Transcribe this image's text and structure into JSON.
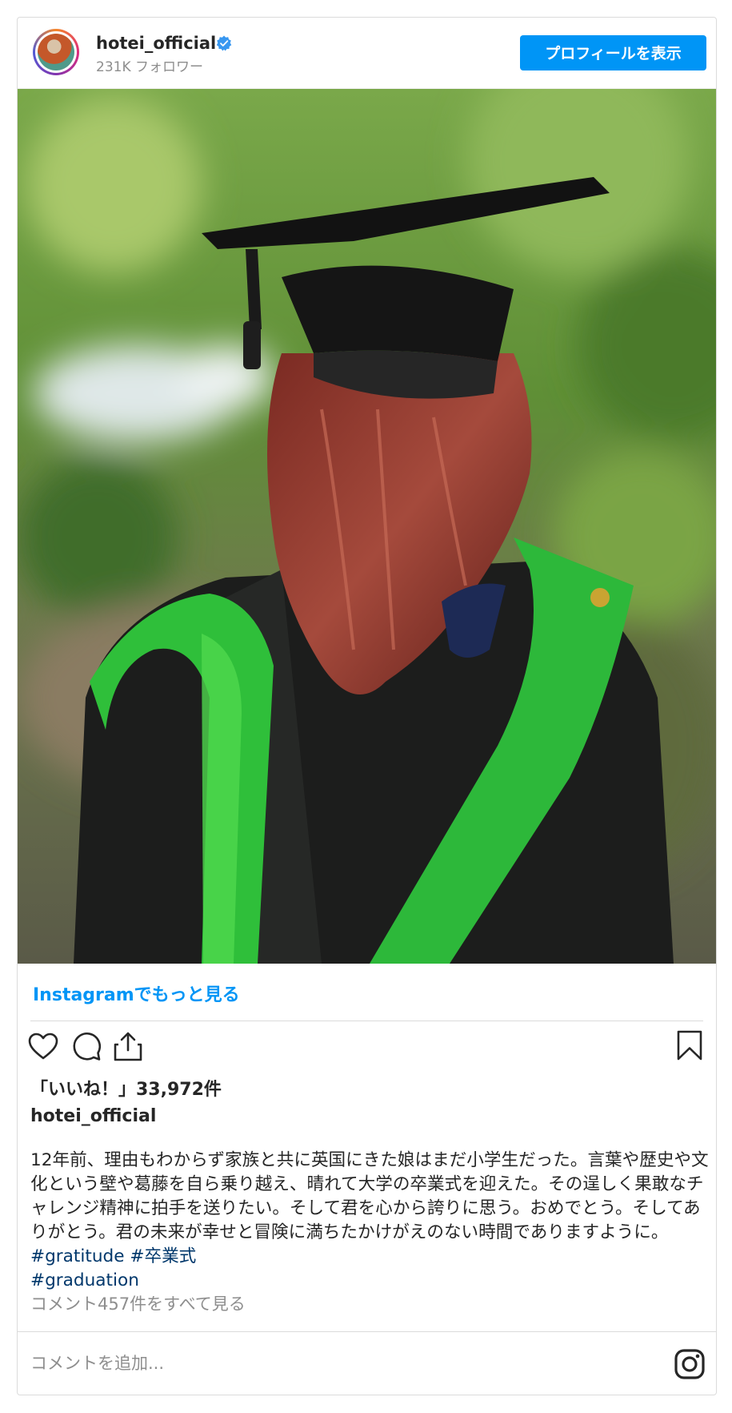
{
  "header": {
    "username": "hotei_official",
    "followers": "231K フォロワー",
    "profile_button": "プロフィールを表示"
  },
  "post": {
    "more_link": "Instagramでもっと見る",
    "likes": "「いいね！」33,972件",
    "caption_user": "hotei_official",
    "caption_text": "12年前、理由もわからず家族と共に英国にきた娘はまだ小学生だった。言葉や歴史や文化という壁や葛藤を自ら乗り越え、晴れて大学の卒業式を迎えた。その逞しく果敢なチャレンジ精神に拍手を送りたい。そして君を心から誇りに思う。おめでとう。そしてありがとう。君の未来が幸せと冒険に満ちたかけがえのない時間でありますように。　",
    "hashtags": [
      "#gratitude",
      "#卒業式",
      "#graduation"
    ],
    "view_comments": "コメント457件をすべて見る"
  },
  "comment_box": {
    "placeholder": "コメントを追加..."
  },
  "colors": {
    "accent": "#0095f6",
    "hashtag": "#00376b",
    "secondary_text": "#8e8e8e",
    "sash_green": "#2fbf3a"
  },
  "icons": [
    "verified-badge-icon",
    "heart-icon",
    "comment-icon",
    "share-icon",
    "bookmark-icon",
    "instagram-logo-icon"
  ]
}
